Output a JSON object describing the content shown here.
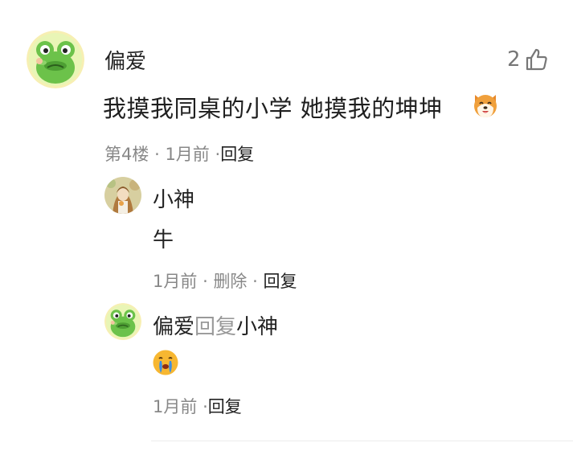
{
  "comment": {
    "author": "偏爱",
    "text": "我摸我同桌的小学 她摸我的坤坤",
    "likes": "2",
    "floor": "第4楼",
    "time": "1月前",
    "reply_label": "回复",
    "dot": "·",
    "emoji_icon": "dog-face-icon",
    "avatar_icon": "frog-avatar-icon"
  },
  "replies": [
    {
      "author": "小神",
      "text": "牛",
      "time": "1月前",
      "delete_label": "删除",
      "reply_label": "回复",
      "dot": "·",
      "avatar_icon": "girl-avatar-icon"
    },
    {
      "author": "偏爱",
      "reply_word": "回复",
      "target": "小神",
      "time": "1月前",
      "reply_label": "回复",
      "dot": "·",
      "emoji_icon": "crying-face-icon",
      "avatar_icon": "frog-avatar-icon"
    }
  ],
  "colors": {
    "meta_gray": "#888888",
    "reply_word_gray": "#999999",
    "frog_green": "#6cc24a"
  }
}
